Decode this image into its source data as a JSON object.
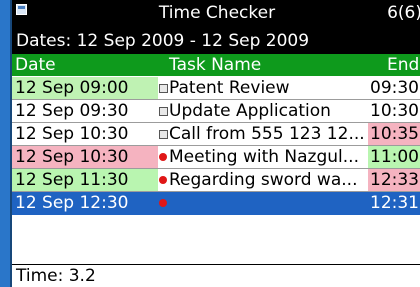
{
  "header": {
    "title": "Time Checker",
    "count": "6(6)",
    "dates": "Dates: 12 Sep 2009 - 12 Sep 2009"
  },
  "columns": {
    "date": "Date",
    "task": "Task Name",
    "end": "End"
  },
  "rows": [
    {
      "date": "12 Sep 09:00",
      "icon": "task-icon",
      "task": "Patent Review",
      "end": "09:30",
      "date_bg": "#bff2b3",
      "end_bg": "#ffffff"
    },
    {
      "date": "12 Sep 09:30",
      "icon": "task-icon",
      "task": "Update Application",
      "end": "10:30",
      "date_bg": "#ffffff",
      "end_bg": "#ffffff"
    },
    {
      "date": "12 Sep 10:30",
      "icon": "task-icon",
      "task": "Call from 555 123 12...",
      "end": "10:35",
      "date_bg": "#ffffff",
      "end_bg": "#f5b3c0"
    },
    {
      "date": "12 Sep 10:30",
      "icon": "dot-icon",
      "task": "Meeting with Nazgul...",
      "end": "11:00",
      "date_bg": "#f5b3c0",
      "end_bg": "#b9f5b0"
    },
    {
      "date": "12 Sep 11:30",
      "icon": "dot-icon",
      "task": "Regarding sword wa...",
      "end": "12:33",
      "date_bg": "#b9f5b0",
      "end_bg": "#f5b3c0"
    },
    {
      "date": "12 Sep 12:30",
      "icon": "dot-icon",
      "task": "",
      "end": "12:31",
      "selected": true
    }
  ],
  "status": {
    "time": "Time: 3.2"
  }
}
